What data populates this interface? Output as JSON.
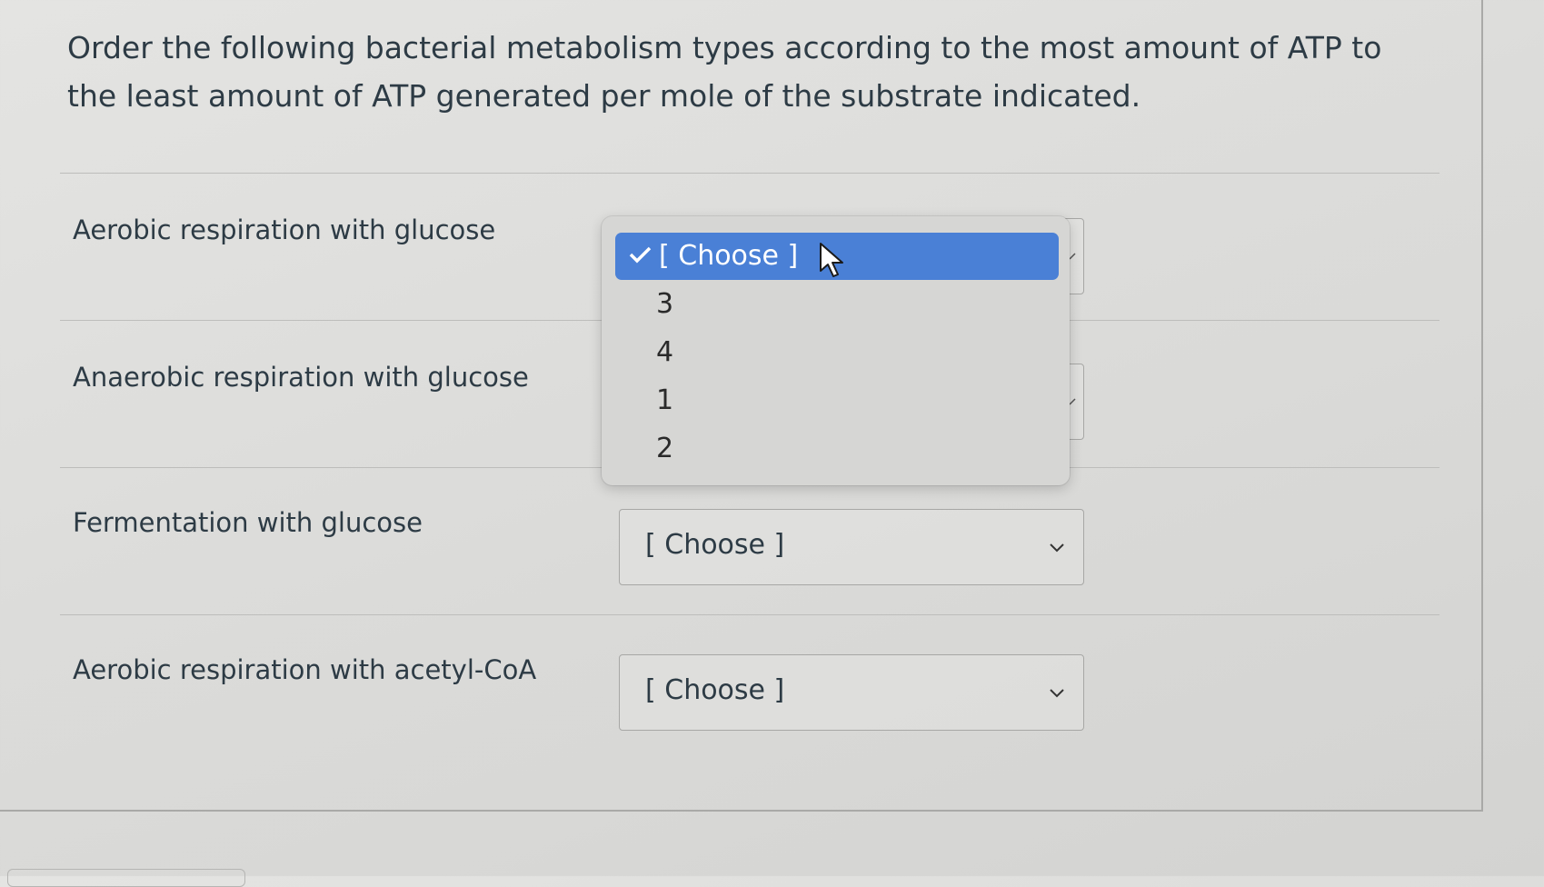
{
  "question": {
    "text": "Order the following bacterial metabolism types according to the most amount of ATP to the least amount of ATP generated per mole of the substrate indicated."
  },
  "rows": [
    {
      "label": "Aerobic respiration with glucose",
      "selected": "[ Choose ]"
    },
    {
      "label": "Anaerobic respiration with glucose",
      "selected": "[ Choose ]"
    },
    {
      "label": "Fermentation with glucose",
      "selected": "[ Choose ]"
    },
    {
      "label": "Aerobic respiration with acetyl-CoA",
      "selected": "[ Choose ]"
    }
  ],
  "dropdown": {
    "options": [
      {
        "label": "[ Choose ]",
        "selected": true,
        "icon": "check-icon"
      },
      {
        "label": "3"
      },
      {
        "label": "4"
      },
      {
        "label": "1"
      },
      {
        "label": "2"
      }
    ]
  },
  "colors": {
    "highlight": "#4a80d6",
    "text": "#2d3b45",
    "background": "#dcdcda"
  }
}
